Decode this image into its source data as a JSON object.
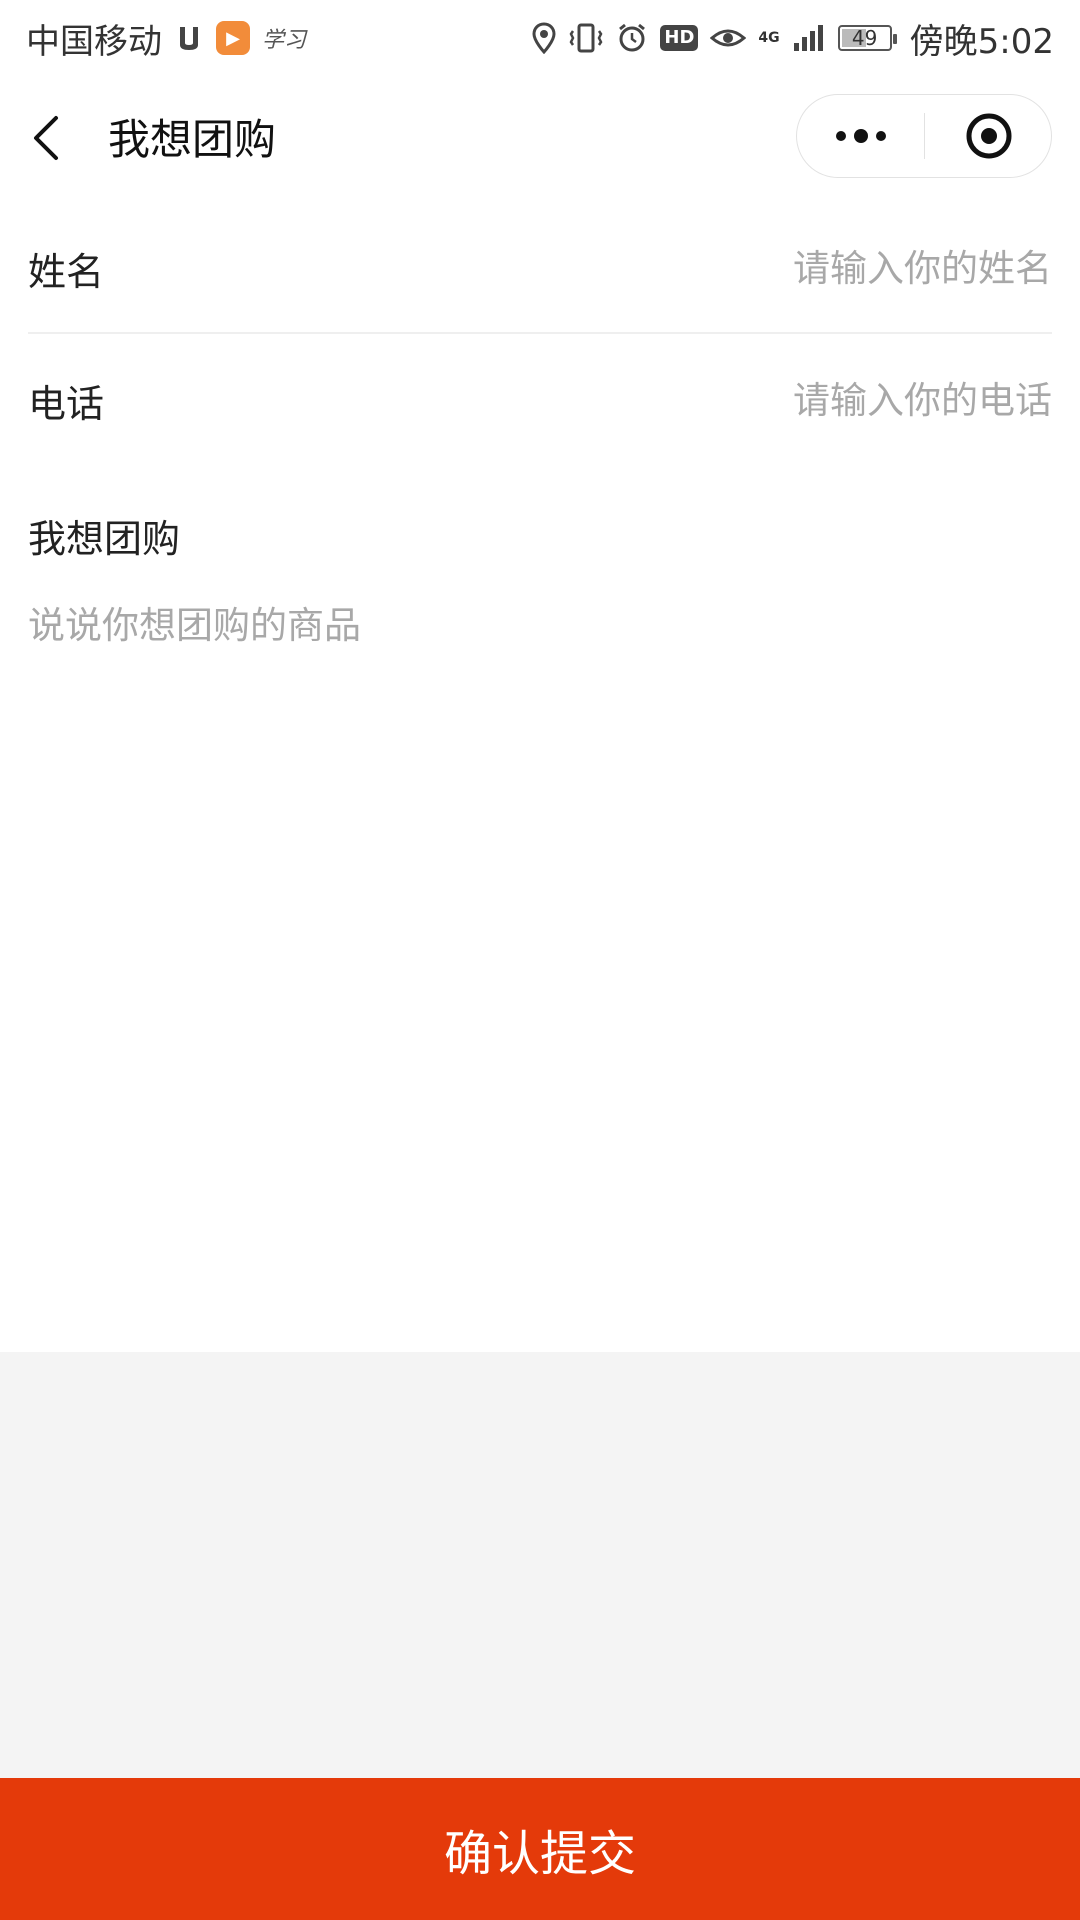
{
  "status_bar": {
    "carrier": "中国移动",
    "app_icons": [
      "notification-icon",
      "video-app-icon",
      "xuexi-app-icon"
    ],
    "xuexi_label": "学习",
    "network": "4G",
    "battery_level": "49",
    "time": "傍晚5:02"
  },
  "header": {
    "title": "我想团购",
    "icons": [
      "back-arrow-icon",
      "more-dots-icon",
      "close-target-icon"
    ]
  },
  "form": {
    "name_label": "姓名",
    "name_placeholder": "请输入你的姓名",
    "name_value": "",
    "phone_label": "电话",
    "phone_placeholder": "请输入你的电话",
    "phone_value": "",
    "wish_label": "我想团购",
    "wish_placeholder": "说说你想团购的商品",
    "wish_value": ""
  },
  "footer": {
    "submit_label": "确认提交"
  },
  "colors": {
    "accent": "#e43a0a",
    "placeholder": "#a8a8a8",
    "background_gray": "#f4f4f4"
  }
}
